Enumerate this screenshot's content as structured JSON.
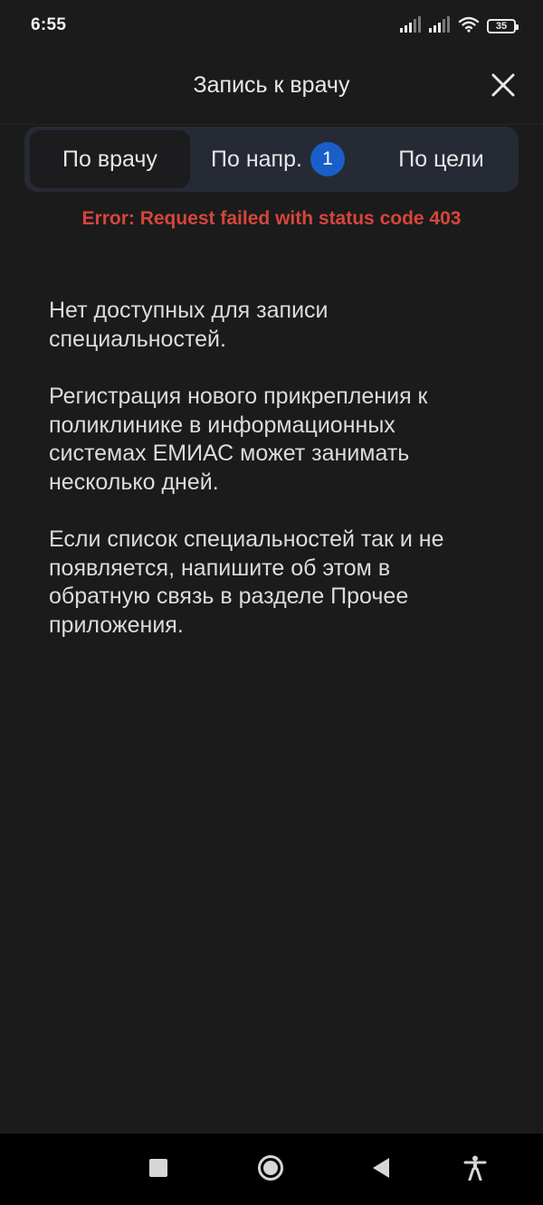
{
  "status_bar": {
    "time": "6:55",
    "battery": "35",
    "icons": [
      "signal-icon",
      "signal-icon",
      "wifi-icon",
      "battery-icon"
    ]
  },
  "header": {
    "title": "Запись к врачу",
    "close_icon": "close-icon"
  },
  "tabs": [
    {
      "label": "По врачу",
      "active": true
    },
    {
      "label": "По напр.",
      "active": false,
      "badge": "1"
    },
    {
      "label": "По цели",
      "active": false
    }
  ],
  "error": "Error: Request failed with status code 403",
  "info": [
    "Нет доступных для записи специальностей.",
    "Регистрация нового прикрепления к поликлинике в информационных системах ЕМИАС может занимать несколько дней.",
    "Если список специальностей так и не появляется, напишите об этом в обратную связь в разделе Прочее приложения."
  ],
  "nav_bar": {
    "icons": [
      "recents-icon",
      "home-icon",
      "back-icon",
      "accessibility-icon"
    ]
  },
  "colors": {
    "background": "#1b1b1c",
    "tab_bar": "#262a35",
    "badge": "#1a5fc9",
    "error": "#d7453b"
  }
}
